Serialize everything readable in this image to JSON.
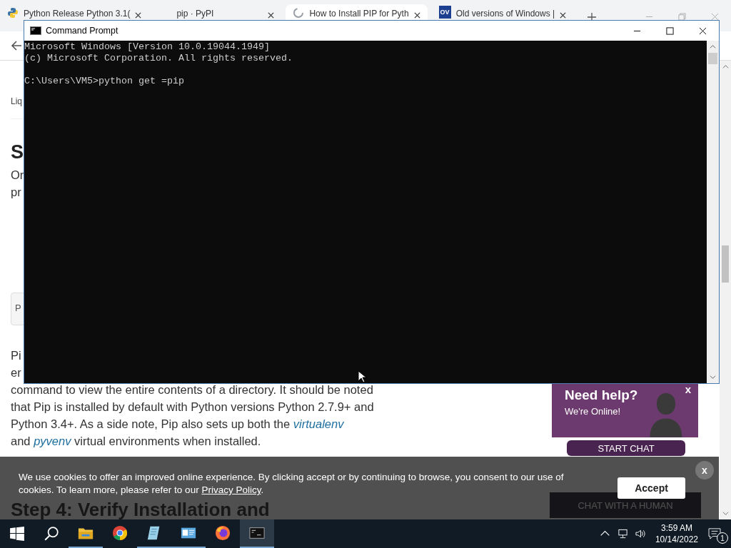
{
  "browser": {
    "tabs": [
      {
        "label": "Python Release Python 3.1(",
        "kind": "python",
        "selected": false
      },
      {
        "label": "pip · PyPI",
        "kind": "blank",
        "selected": false
      },
      {
        "label": "How to Install PIP for Pyth",
        "kind": "loading",
        "selected": true
      },
      {
        "label": "Old versions of Windows |",
        "kind": "lettermark",
        "icon_text": "OV",
        "selected": false
      }
    ]
  },
  "page": {
    "header_fragment": "Liq",
    "heading_fragment": "S",
    "paragraph_fragments": [
      "Or",
      "pr"
    ],
    "code_fragment": "P",
    "body_lines": [
      [
        {
          "kind": "text",
          "text": "Pi"
        }
      ],
      [
        {
          "kind": "text",
          "text": "er"
        }
      ],
      [
        {
          "kind": "text",
          "text": "command to view the entire contents of a directory. It should be noted"
        }
      ],
      [
        {
          "kind": "text",
          "text": "that Pip is installed by default with Python versions Python 2.7.9+ and"
        }
      ],
      [
        {
          "kind": "text",
          "text": "Python 3.4+. As a side note, Pip also sets up both the "
        },
        {
          "kind": "link",
          "text": "virtualenv"
        }
      ],
      [
        {
          "kind": "text",
          "text": "and "
        },
        {
          "kind": "link",
          "text": "pyvenv"
        },
        {
          "kind": "text",
          "text": " virtual environments when installed."
        }
      ]
    ],
    "step_heading": "Step 4: Verify Installation and"
  },
  "chat_widget": {
    "title": "Need help?",
    "subtitle": "We're Online!",
    "close": "x",
    "button": "START CHAT",
    "secondary_button": "CHAT WITH A HUMAN"
  },
  "cookie_banner": {
    "text": "We use cookies to offer an improved online experience. By clicking accept or by continuing to browse, you consent to our use of cookies. To learn more, please refer to our ",
    "link": "Privacy Policy",
    "text_end": ".",
    "button": "Accept",
    "close": "x"
  },
  "command_prompt": {
    "title": "Command Prompt",
    "lines": [
      "Microsoft Windows [Version 10.0.19044.1949]",
      "(c) Microsoft Corporation. All rights reserved."
    ],
    "prompt": "C:\\Users\\VM5>python get =pip"
  },
  "taskbar": {
    "apps": [
      {
        "kind": "explorer",
        "running": true,
        "selected": false
      },
      {
        "kind": "chrome",
        "running": false,
        "selected": false
      },
      {
        "kind": "notepad",
        "running": true,
        "selected": false
      },
      {
        "kind": "panel",
        "running": true,
        "selected": false
      },
      {
        "kind": "firefox",
        "running": false,
        "selected": false
      },
      {
        "kind": "terminal",
        "running": true,
        "selected": true
      }
    ],
    "time": "3:59 AM",
    "date": "10/14/2022",
    "notification_count": "1"
  }
}
